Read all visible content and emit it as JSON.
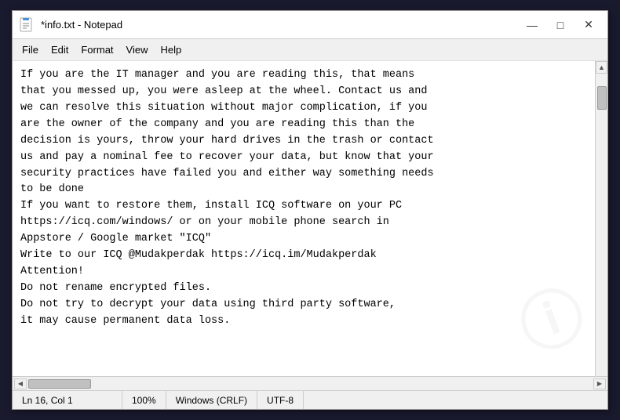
{
  "window": {
    "title": "*info.txt - Notepad",
    "icon": "notepad-icon"
  },
  "menu": {
    "items": [
      "File",
      "Edit",
      "Format",
      "View",
      "Help"
    ]
  },
  "content": {
    "text": "If you are the IT manager and you are reading this, that means\nthat you messed up, you were asleep at the wheel. Contact us and\nwe can resolve this situation without major complication, if you\nare the owner of the company and you are reading this than the\ndecision is yours, throw your hard drives in the trash or contact\nus and pay a nominal fee to recover your data, but know that your\nsecurity practices have failed you and either way something needs\nto be done\nIf you want to restore them, install ICQ software on your PC\nhttps://icq.com/windows/ or on your mobile phone search in\nAppstore / Google market \"ICQ\"\nWrite to our ICQ @Mudakperdak https://icq.im/Mudakperdak\nAttention!\nDo not rename encrypted files.\nDo not try to decrypt your data using third party software,\nit may cause permanent data loss."
  },
  "controls": {
    "minimize": "—",
    "maximize": "□",
    "close": "✕"
  },
  "status_bar": {
    "position": "Ln 16, Col 1",
    "zoom": "100%",
    "line_ending": "Windows (CRLF)",
    "encoding": "UTF-8"
  },
  "watermark": {
    "lines": [
      "ℹ️"
    ]
  }
}
